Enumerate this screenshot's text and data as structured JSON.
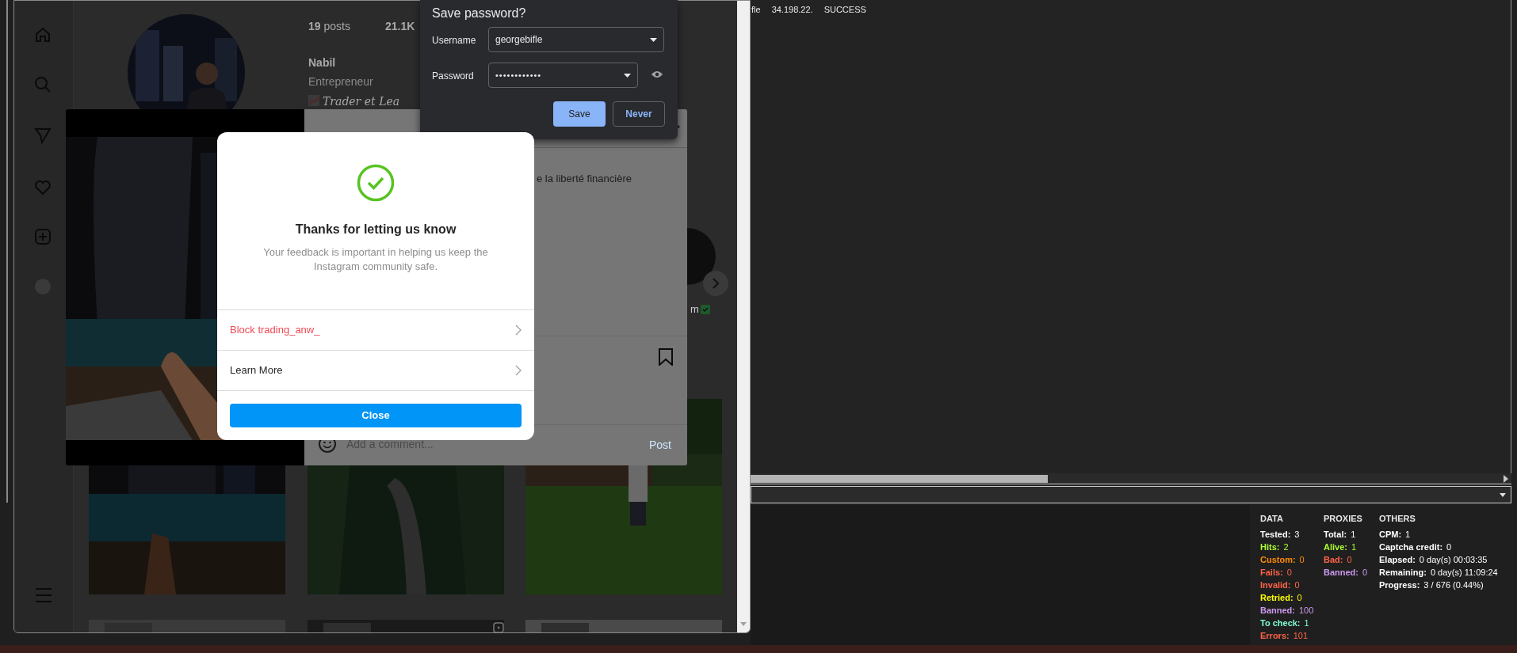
{
  "browser": {
    "profile": {
      "posts": "**19** posts",
      "followers": "21.1K",
      "name": "Nabil",
      "category": "Entrepreneur",
      "bio": "Trader et Lea"
    },
    "post": {
      "caption": "e la liberté financière",
      "tag": "m",
      "comment_placeholder": "Add a comment...",
      "post_button": "Post"
    },
    "save_password": {
      "title": "Save password?",
      "username_label": "Username",
      "username": "georgebifle",
      "password_label": "Password",
      "password": "••••••••••••",
      "save_button": "Save",
      "never_button": "Never"
    },
    "feedback": {
      "title": "Thanks for letting us know",
      "message": "Your feedback is important in helping us keep the Instagram community safe.",
      "options": [
        {
          "label": "Block trading_anw_",
          "kind": "danger"
        },
        {
          "label": "Learn More",
          "kind": "normal"
        }
      ],
      "close_button": "Close"
    }
  },
  "checker": {
    "log_row": [
      "fle",
      "34.198.22.",
      "SUCCESS"
    ],
    "stats": [
      {
        "title": "DATA",
        "rows": [
          {
            "label": "Tested:",
            "value": "3",
            "color": "#ffffff"
          },
          {
            "label": "Hits:",
            "value": "2",
            "color": "#adff2f"
          },
          {
            "label": "Custom:",
            "value": "0",
            "color": "#ff8c00"
          },
          {
            "label": "Fails:",
            "value": "0",
            "color": "#ff6347"
          },
          {
            "label": "Invalid:",
            "value": "0",
            "color": "#ff6347"
          },
          {
            "label": "Retried:",
            "value": "0",
            "color": "#ffff00"
          },
          {
            "label": "Banned:",
            "value": "100",
            "color": "#cc99ee"
          },
          {
            "label": "To check:",
            "value": "1",
            "color": "#7fffd4"
          },
          {
            "label": "Errors:",
            "value": "101",
            "color": "#ff6347"
          }
        ]
      },
      {
        "title": "PROXIES",
        "rows": [
          {
            "label": "Total:",
            "value": "1",
            "color": "#ffffff"
          },
          {
            "label": "Alive:",
            "value": "1",
            "color": "#adff2f"
          },
          {
            "label": "Bad:",
            "value": "0",
            "color": "#ff6347"
          },
          {
            "label": "Banned:",
            "value": "0",
            "color": "#cc99ee"
          }
        ]
      },
      {
        "title": "OTHERS",
        "rows": [
          {
            "label": "CPM:",
            "value": "1",
            "color": "#ffffff"
          },
          {
            "label": "Captcha credit:",
            "value": "0",
            "color": "#ffffff"
          },
          {
            "label": "Elapsed:",
            "value": "0 day(s) 00:03:35",
            "color": "#ffffff"
          },
          {
            "label": "Remaining:",
            "value": "0 day(s) 11:09:24",
            "color": "#ffffff"
          },
          {
            "label": "Progress:",
            "value": "3 / 676 (0.44%)",
            "color": "#ffffff"
          }
        ]
      }
    ]
  }
}
